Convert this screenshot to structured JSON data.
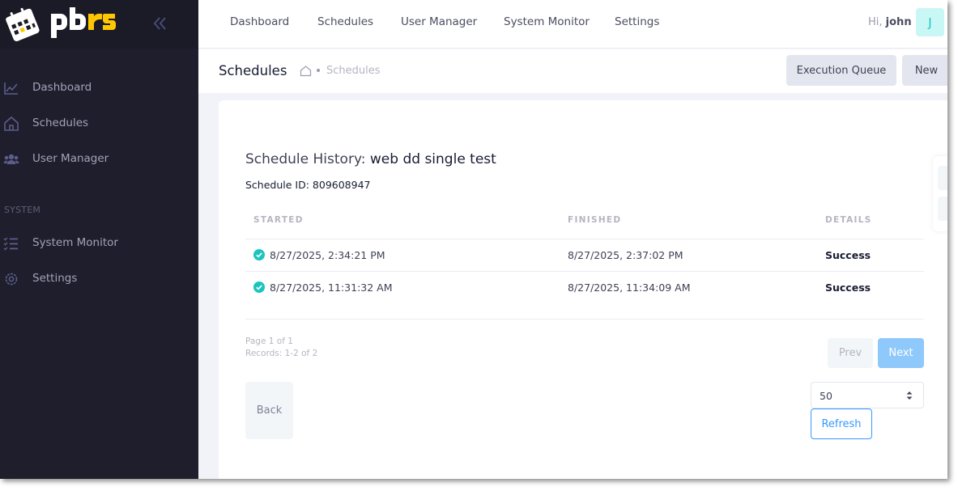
{
  "app": {
    "logo_text": "pbrs"
  },
  "sidebar": {
    "items": [
      {
        "label": "Dashboard",
        "icon": "chart-line-icon"
      },
      {
        "label": "Schedules",
        "icon": "home-icon"
      },
      {
        "label": "User Manager",
        "icon": "users-icon"
      }
    ],
    "section_label": "SYSTEM",
    "system_items": [
      {
        "label": "System Monitor",
        "icon": "checklist-icon"
      },
      {
        "label": "Settings",
        "icon": "gear-icon"
      }
    ]
  },
  "topnav": {
    "links": [
      "Dashboard",
      "Schedules",
      "User Manager",
      "System Monitor",
      "Settings"
    ],
    "greeting_prefix": "Hi,",
    "username": "john",
    "avatar_initial": "J"
  },
  "subheader": {
    "title": "Schedules",
    "breadcrumb_current": "Schedules",
    "buttons": {
      "execution_queue": "Execution Queue",
      "new": "New"
    }
  },
  "history": {
    "title_prefix": "Schedule History:",
    "schedule_name": "web dd single test",
    "schedule_id_label": "Schedule ID: 809608947",
    "columns": [
      "STARTED",
      "FINISHED",
      "DETAILS"
    ],
    "rows": [
      {
        "started": "8/27/2025, 2:34:21 PM",
        "finished": "8/27/2025, 2:37:02 PM",
        "details": "Success",
        "status": "success"
      },
      {
        "started": "8/27/2025, 11:31:32 AM",
        "finished": "8/27/2025, 11:34:09 AM",
        "details": "Success",
        "status": "success"
      }
    ],
    "page_info": "Page 1 of 1",
    "records_info": "Records: 1-2 of 2",
    "prev_label": "Prev",
    "next_label": "Next",
    "back_label": "Back",
    "page_size": "50",
    "refresh_label": "Refresh"
  },
  "colors": {
    "sidebar_bg": "#1e1e2d",
    "success": "#1bc5bd",
    "primary": "#3699ff",
    "logo_yellow": "#ffc700"
  }
}
